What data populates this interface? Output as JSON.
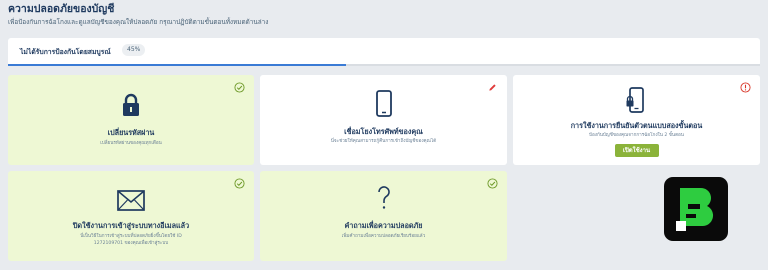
{
  "header": {
    "title": "ความปลอดภัยของบัญชี",
    "subtitle": "เพื่อป้องกันการฉ้อโกงและดูแลบัญชีของคุณให้ปลอดภัย กรุณาปฏิบัติตามขั้นตอนทั้งหมดด้านล่าง"
  },
  "progress": {
    "label": "ไม่ได้รับการป้องกันโดยสมบูรณ์",
    "percent_text": "45%",
    "percent": 45
  },
  "cards": [
    {
      "title": "เปลี่ยนรหัสผ่าน",
      "desc": "เปลี่ยนรหัสผ่านของคุณทุกเดือน",
      "icon": "lock-icon",
      "status": "done"
    },
    {
      "title": "เชื่อมโยงโทรศัพท์ของคุณ",
      "desc": "นี่จะช่วยให้คุณสามารถกู้คืนการเข้าถึงบัญชีของคุณได้",
      "icon": "smartphone-icon",
      "status": "edit"
    },
    {
      "title": "การใช้งานการยืนยันตัวตนแบบสองขั้นตอน",
      "desc": "ป้องกันบัญชีของคุณจากการฉ้อโกงใน 2 ขั้นตอน",
      "icon": "phone-lock-icon",
      "status": "warning",
      "button": "เปิดใช้งาน"
    },
    {
      "title": "ปิดใช้งานการเข้าสู่ระบบทางอีเมลแล้ว",
      "desc_line1": "นี่เป็นวิธีในการเข้าสู่ระบบที่ปลอดภัยยิ่งขึ้นโดยใช้ ID",
      "desc_line2": "1272109701 ของคุณเพื่อเข้าสู่ระบบ",
      "icon": "envelope-icon",
      "status": "done"
    },
    {
      "title": "คำถามเพื่อความปลอดภัย",
      "desc": "เพิ่มคำถามเพื่อความปลอดภัยเรียบร้อยแล้ว",
      "icon": "question-mark-icon",
      "status": "done"
    }
  ],
  "colors": {
    "done_bg": "#eef8d4",
    "check_green": "#8bb33a",
    "warning_red": "#d9382b",
    "edit_red": "#e03b3b",
    "progress_blue": "#3a7bd5",
    "text_navy": "#1f3a5f"
  }
}
